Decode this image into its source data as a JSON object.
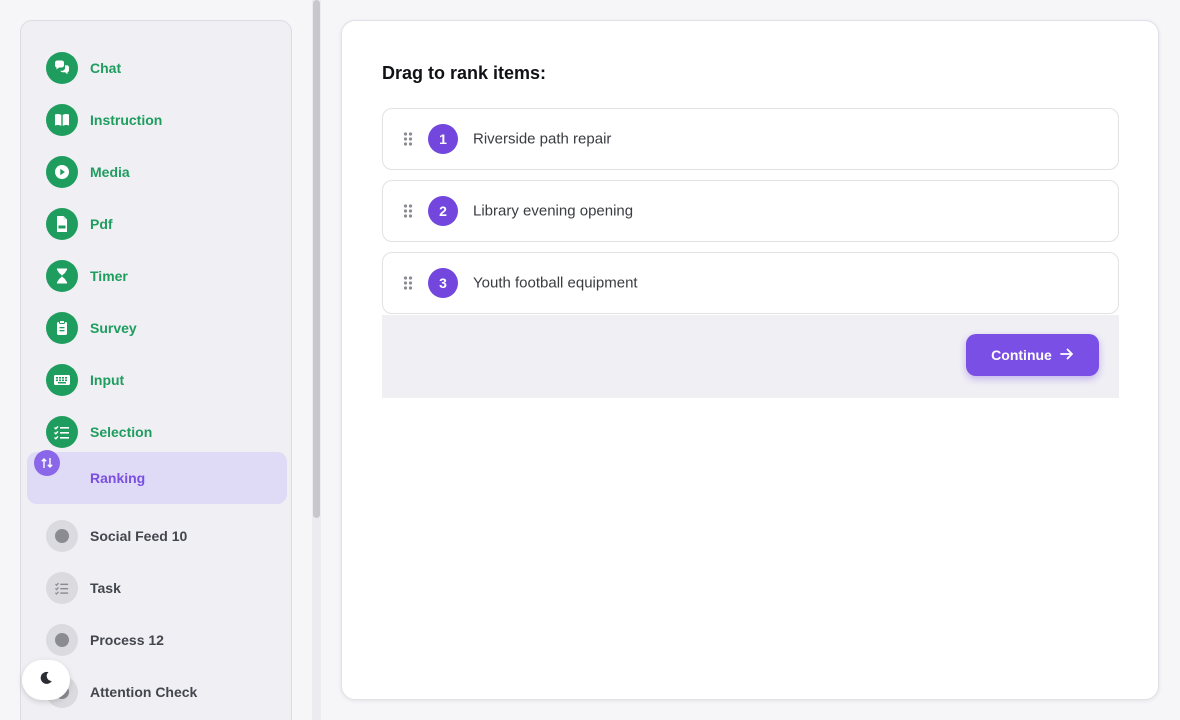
{
  "sidebar": {
    "items": [
      {
        "label": "Chat",
        "icon": "chat-icon",
        "status": "done"
      },
      {
        "label": "Instruction",
        "icon": "book-icon",
        "status": "done"
      },
      {
        "label": "Media",
        "icon": "play-icon",
        "status": "done"
      },
      {
        "label": "Pdf",
        "icon": "pdf-file-icon",
        "status": "done"
      },
      {
        "label": "Timer",
        "icon": "hourglass-icon",
        "status": "done"
      },
      {
        "label": "Survey",
        "icon": "clipboard-icon",
        "status": "done"
      },
      {
        "label": "Input",
        "icon": "keyboard-icon",
        "status": "done"
      },
      {
        "label": "Selection",
        "icon": "checklist-icon",
        "status": "done"
      },
      {
        "label": "Ranking",
        "icon": "sort-arrows-icon",
        "status": "active"
      },
      {
        "label": "Social Feed 10",
        "icon": "dot-icon",
        "status": "pending"
      },
      {
        "label": "Task",
        "icon": "checklist-icon",
        "status": "pending"
      },
      {
        "label": "Process 12",
        "icon": "dot-icon",
        "status": "pending"
      },
      {
        "label": "Attention Check",
        "icon": "dot-icon",
        "status": "pending"
      }
    ]
  },
  "theme_toggle": {
    "icon": "moon-icon"
  },
  "main": {
    "title": "Drag to rank items:",
    "items": [
      {
        "rank": "1",
        "label": "Riverside path repair"
      },
      {
        "rank": "2",
        "label": "Library evening opening"
      },
      {
        "rank": "3",
        "label": "Youth football equipment"
      }
    ],
    "continue_label": "Continue"
  },
  "colors": {
    "done_green": "#1f9d5f",
    "accent_purple": "#7a4fe6",
    "active_bg": "#dfdaf6"
  }
}
